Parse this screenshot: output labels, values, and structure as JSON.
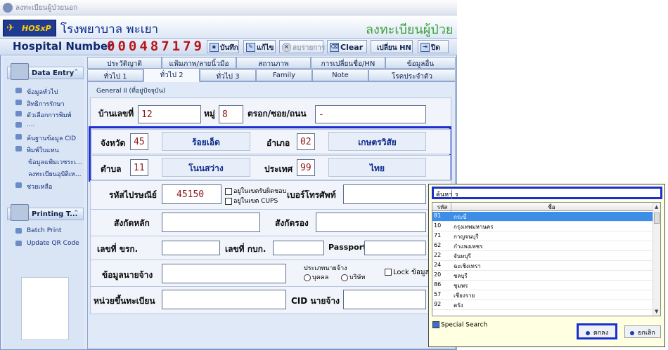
{
  "window": {
    "title": "ลงทะเบียนผู้ป่วยนอก"
  },
  "header": {
    "logo": "HOSxP",
    "hospital_name": "โรงพยาบาล พะเยา",
    "form_title": "ลงทะเบียนผู้ป่วย"
  },
  "hn": {
    "label": "Hospital Number",
    "value": "000487179"
  },
  "toolbar": {
    "save": "บันทึก",
    "edit": "แก้ไข",
    "delete": "ลบรายการ",
    "clear": "Clear",
    "change_hn": "เปลี่ยน HN",
    "close": "ปิด"
  },
  "sidebar": {
    "data_entry": {
      "title": "Data Entry",
      "items": [
        "ข้อมูลทั่วไป",
        "สิทธิการรักษา",
        "ตัวเลือกการพิมพ์",
        "....",
        "ค้นฐานข้อมูล CID",
        "พิมพ์ใบแทน",
        "ข้อมูลแฟ้มเวชระเ...",
        "ลงทะเบียนอุปัติเห...",
        "ช่วยเหลือ"
      ]
    },
    "printing": {
      "title": "Printing T...",
      "items": [
        "Batch Print",
        "Update QR Code"
      ]
    }
  },
  "tabs_row1": [
    "ประวัติญาติ",
    "แฟ้มภาพ/ลายนิ้วมือ",
    "สถานภาพ",
    "การเปลี่ยนชื่อ/HN",
    "ข้อมูลอื่น"
  ],
  "tabs_row2": [
    "ทั่วไป 1",
    "ทั่วไป 2",
    "ทั่วไป 3",
    "Family",
    "Note",
    "โรคประจำตัว"
  ],
  "form": {
    "group_title": "General II (ที่อยู่ปัจจุบัน)",
    "house_no_label": "บ้านเลขที่",
    "house_no": "12",
    "moo_label": "หมู่",
    "moo": "8",
    "soi_label": "ตรอก/ซอย/ถนน",
    "soi": "-",
    "province_label": "จังหวัด",
    "province_code": "45",
    "province_name": "ร้อยเอ็ด",
    "amphur_label": "อำเภอ",
    "amphur_code": "02",
    "amphur_name": "เกษตรวิสัย",
    "tambon_label": "ตำบล",
    "tambon_code": "11",
    "tambon_name": "โนนสว่าง",
    "country_label": "ประเทศ",
    "country_code": "99",
    "country_name": "ไทย",
    "zip_label": "รหัสไปรษณีย์",
    "zip": "45150",
    "in_area_label": "อยู่ในเขตรับผิดชอบ",
    "in_cups_label": "อยู่ในเขต CUPS",
    "phone_label": "เบอร์โทรศัพท์",
    "main_aff_label": "สังกัดหลัก",
    "sub_aff_label": "สังกัดรอง",
    "civil_no_label": "เลขที่ ขรก.",
    "army_no_label": "เลขที่ กบก.",
    "passport_label": "Passport",
    "employer_label": "ข้อมูลนายจ้าง",
    "employer_type_label": "ประเภทนายจ้าง",
    "person_label": "บุคคล",
    "company_label": "บริษัท",
    "lock_label": "Lock ข้อมูลที่",
    "reg_unit_label": "หน่วยขึ้นทะเบียน",
    "cid_employer_label": "CID นายจ้าง"
  },
  "popup": {
    "search_label": "ค้นหา",
    "search_value": "ร",
    "col_code": "รหัส",
    "col_name": "ชื่อ",
    "rows": [
      {
        "code": "81",
        "name": "กระบี่"
      },
      {
        "code": "10",
        "name": "กรุงเทพมหานคร"
      },
      {
        "code": "71",
        "name": "กาญจนบุรี"
      },
      {
        "code": "62",
        "name": "กำแพงเพชร"
      },
      {
        "code": "22",
        "name": "จันทบุรี"
      },
      {
        "code": "24",
        "name": "ฉะเชิงเทรา"
      },
      {
        "code": "20",
        "name": "ชลบุรี"
      },
      {
        "code": "86",
        "name": "ชุมพร"
      },
      {
        "code": "57",
        "name": "เชียงราย"
      },
      {
        "code": "92",
        "name": "ตรัง"
      }
    ],
    "special_search": "Special Search",
    "ok": "ตกลง",
    "cancel": "ยกเลิก"
  },
  "colors": {
    "accent": "#1a2fd0",
    "hn": "#b8161b",
    "title_green": "#3ca13c",
    "selected_row": "#3d8ee8"
  }
}
